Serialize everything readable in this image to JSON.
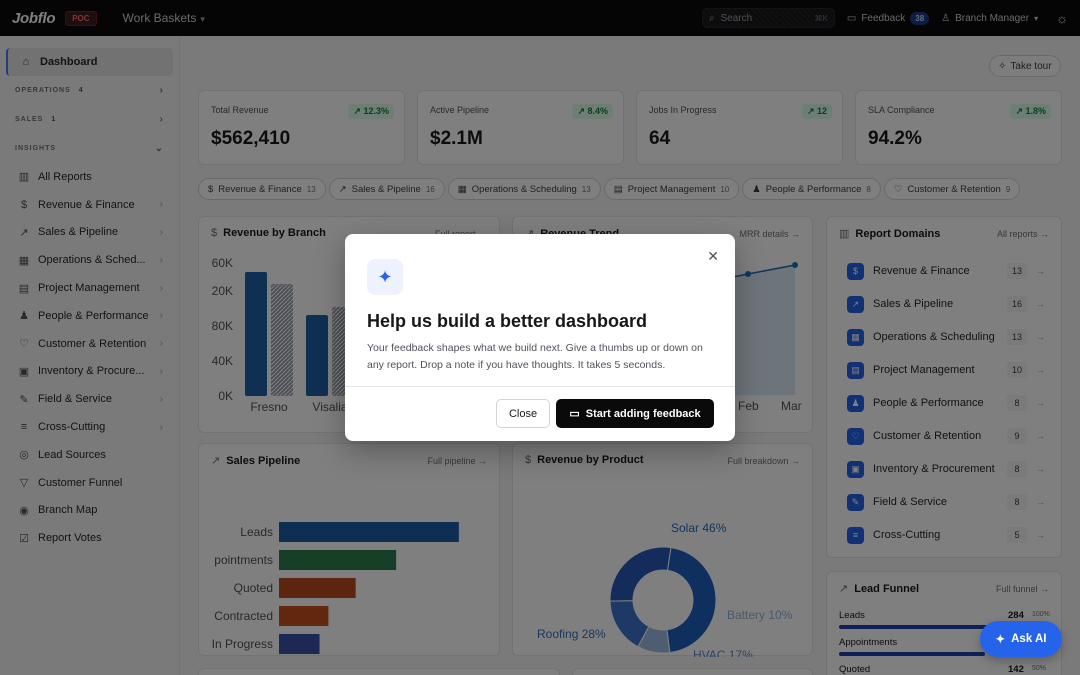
{
  "app": {
    "logo": "Jobflo",
    "env_badge": "POC",
    "workspace": "Work Baskets"
  },
  "topbar": {
    "search_placeholder": "Search",
    "search_shortcut": "⌘K",
    "feedback_label": "Feedback",
    "feedback_count": "38",
    "role": "Branch Manager"
  },
  "sidebar": {
    "dashboard": "Dashboard",
    "operations": {
      "label": "OPERATIONS",
      "count": "4"
    },
    "sales": {
      "label": "SALES",
      "count": "1"
    },
    "insights": {
      "label": "INSIGHTS"
    },
    "items": [
      {
        "label": "All Reports",
        "icon": "bar-chart-icon",
        "chev": false
      },
      {
        "label": "Revenue & Finance",
        "icon": "dollar-icon",
        "chev": true
      },
      {
        "label": "Sales & Pipeline",
        "icon": "trend-icon",
        "chev": true
      },
      {
        "label": "Operations & Sched...",
        "icon": "calendar-icon",
        "chev": true
      },
      {
        "label": "Project Management",
        "icon": "clipboard-icon",
        "chev": true
      },
      {
        "label": "People & Performance",
        "icon": "people-icon",
        "chev": true
      },
      {
        "label": "Customer & Retention",
        "icon": "heart-icon",
        "chev": true
      },
      {
        "label": "Inventory & Procure...",
        "icon": "box-icon",
        "chev": true
      },
      {
        "label": "Field & Service",
        "icon": "wrench-icon",
        "chev": true
      },
      {
        "label": "Cross-Cutting",
        "icon": "layers-icon",
        "chev": true
      },
      {
        "label": "Lead Sources",
        "icon": "target-icon",
        "chev": false
      },
      {
        "label": "Customer Funnel",
        "icon": "funnel-icon",
        "chev": false
      },
      {
        "label": "Branch Map",
        "icon": "map-pin-icon",
        "chev": false
      },
      {
        "label": "Report Votes",
        "icon": "vote-icon",
        "chev": false
      }
    ]
  },
  "main": {
    "take_tour": "Take tour",
    "kpis": [
      {
        "label": "Total Revenue",
        "value": "$562,410",
        "delta": "12.3%"
      },
      {
        "label": "Active Pipeline",
        "value": "$2.1M",
        "delta": "8.4%"
      },
      {
        "label": "Jobs In Progress",
        "value": "64",
        "delta": "12"
      },
      {
        "label": "SLA Compliance",
        "value": "94.2%",
        "delta": "1.8%"
      }
    ],
    "chips": [
      {
        "label": "Revenue & Finance",
        "count": "13"
      },
      {
        "label": "Sales & Pipeline",
        "count": "16"
      },
      {
        "label": "Operations & Scheduling",
        "count": "13"
      },
      {
        "label": "Project Management",
        "count": "10"
      },
      {
        "label": "People & Performance",
        "count": "8"
      },
      {
        "label": "Customer & Retention",
        "count": "9"
      }
    ],
    "revenue_by_branch": {
      "title": "Revenue by Branch",
      "link": "Full report"
    },
    "revenue_trend": {
      "title": "Revenue Trend",
      "link": "MRR details"
    },
    "sales_pipeline": {
      "title": "Sales Pipeline",
      "link": "Full pipeline"
    },
    "revenue_by_product": {
      "title": "Revenue by Product",
      "link": "Full breakdown"
    },
    "report_domains": {
      "title": "Report Domains",
      "link": "All reports",
      "rows": [
        {
          "label": "Revenue & Finance",
          "count": "13",
          "icon": "$"
        },
        {
          "label": "Sales & Pipeline",
          "count": "16",
          "icon": "↗"
        },
        {
          "label": "Operations & Scheduling",
          "count": "13",
          "icon": "▦"
        },
        {
          "label": "Project Management",
          "count": "10",
          "icon": "▤"
        },
        {
          "label": "People & Performance",
          "count": "8",
          "icon": "♟"
        },
        {
          "label": "Customer & Retention",
          "count": "9",
          "icon": "♡"
        },
        {
          "label": "Inventory & Procurement",
          "count": "8",
          "icon": "▣"
        },
        {
          "label": "Field & Service",
          "count": "8",
          "icon": "✎"
        },
        {
          "label": "Cross-Cutting",
          "count": "5",
          "icon": "≡"
        }
      ]
    },
    "lead_funnel": {
      "title": "Lead Funnel",
      "link": "Full funnel",
      "rows": [
        {
          "label": "Leads",
          "value": "284",
          "pct": "100%",
          "fill": 1.0
        },
        {
          "label": "Appointments",
          "value": "",
          "pct": "",
          "fill": 0.77
        },
        {
          "label": "Quoted",
          "value": "142",
          "pct": "50%",
          "fill": 0.5
        }
      ]
    }
  },
  "chart_data": [
    {
      "type": "bar",
      "title": "Revenue by Branch",
      "categories": [
        "Fresno",
        "Visalia"
      ],
      "series": [
        {
          "values": [
            124000,
            81000
          ]
        },
        {
          "values": [
            112000,
            89000
          ]
        }
      ],
      "y_tick_labels": [
        "60K",
        "20K",
        "80K",
        "40K",
        "0K"
      ]
    },
    {
      "type": "line",
      "title": "Revenue Trend",
      "x": [
        "Feb",
        "Mar"
      ],
      "series": [
        {
          "values": [
            0.82,
            0.9
          ]
        }
      ]
    },
    {
      "type": "bar",
      "orientation": "horizontal",
      "title": "Sales Pipeline",
      "categories": [
        "Leads",
        "pointments",
        "Quoted",
        "Contracted",
        "In Progress"
      ],
      "values": [
        284,
        185,
        121,
        78,
        64
      ],
      "x_ticks": [
        "0",
        "75",
        "150",
        "225",
        "300"
      ],
      "colors": [
        "#1d5fa6",
        "#2f7d4d",
        "#b84a1e",
        "#c2501f",
        "#3a53a8"
      ]
    },
    {
      "type": "pie",
      "title": "Revenue by Product",
      "slices": [
        {
          "label": "Solar 46%",
          "value": 46
        },
        {
          "label": "Battery 10%",
          "value": 10
        },
        {
          "label": "HVAC 17%",
          "value": 17
        },
        {
          "label": "Roofing 28%",
          "value": 28
        }
      ]
    }
  ],
  "modal": {
    "title": "Help us build a better dashboard",
    "body": "Your feedback shapes what we build next. Give a thumbs up or down on any report. Drop a note if you have thoughts. It takes 5 seconds.",
    "close_label": "Close",
    "start_label": "Start adding feedback"
  },
  "ask_ai": "Ask AI"
}
